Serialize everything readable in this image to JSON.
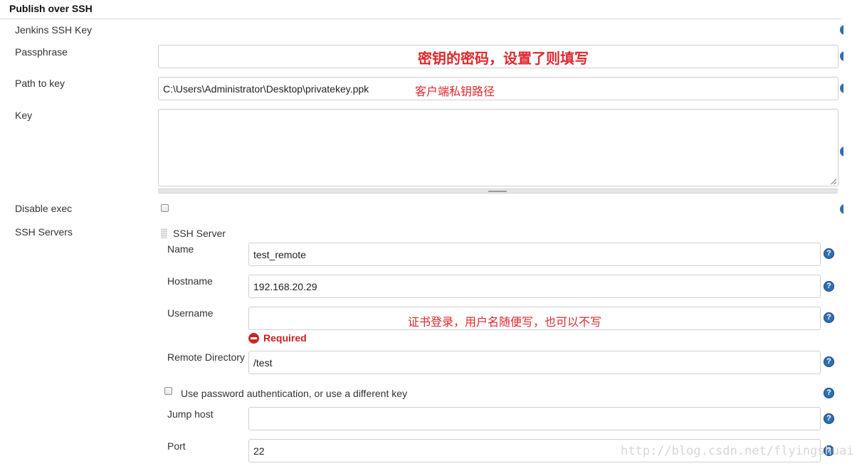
{
  "section": {
    "title": "Publish over SSH"
  },
  "fields": {
    "jenkins_ssh_key": {
      "label": "Jenkins SSH Key"
    },
    "passphrase": {
      "label": "Passphrase",
      "value": "",
      "annotation": "密钥的密码，设置了则填写"
    },
    "path_to_key": {
      "label": "Path to key",
      "value": "C:\\Users\\Administrator\\Desktop\\privatekey.ppk",
      "annotation": "客户端私钥路径"
    },
    "key": {
      "label": "Key",
      "value": ""
    },
    "disable_exec": {
      "label": "Disable exec",
      "checked": false
    }
  },
  "ssh_servers": {
    "label": "SSH Servers",
    "server_header": "SSH Server",
    "name": {
      "label": "Name",
      "value": "test_remote"
    },
    "hostname": {
      "label": "Hostname",
      "value": "192.168.20.29"
    },
    "username": {
      "label": "Username",
      "value": "",
      "annotation": "证书登录，用户名随便写，也可以不写",
      "required_text": "Required"
    },
    "remote_directory": {
      "label": "Remote Directory",
      "value": "/test"
    },
    "use_password": {
      "label": "Use password authentication, or use a different key",
      "checked": false
    },
    "jump_host": {
      "label": "Jump host",
      "value": ""
    },
    "port": {
      "label": "Port",
      "value": "22"
    }
  },
  "help_icon_glyph": "?",
  "watermark": "http://blog.csdn.net/flyingshuai",
  "colors": {
    "help": "#2f6fb0",
    "required": "#cc1f1f",
    "annotation": "#e0282c"
  }
}
